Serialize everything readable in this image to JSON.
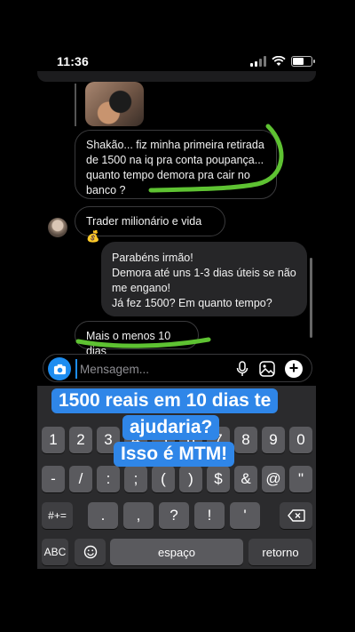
{
  "status_bar": {
    "time": "11:36"
  },
  "messages": [
    {
      "id": "m1",
      "direction": "incoming",
      "text": "Shakão... fiz minha primeira retirada de 1500 na iq pra conta poupança... quanto tempo demora pra cair no banco ?"
    },
    {
      "id": "m2",
      "direction": "incoming",
      "text": "Trader milionário e vida💰"
    },
    {
      "id": "m3",
      "direction": "outgoing",
      "text": "Parabéns irmão!\nDemora até uns 1-3 dias úteis se não me engano!\nJá fez 1500? Em quanto tempo?"
    },
    {
      "id": "m4",
      "direction": "incoming",
      "text": "Mais o menos 10 dias"
    }
  ],
  "composer": {
    "placeholder": "Mensagem..."
  },
  "keyboard": {
    "row1": [
      "1",
      "2",
      "3",
      "4",
      "5",
      "6",
      "7",
      "8",
      "9",
      "0"
    ],
    "row2": [
      "-",
      "/",
      ":",
      ";",
      "(",
      ")",
      "$",
      "&",
      "@",
      "\""
    ],
    "row3": [
      "#+=",
      ".",
      ",",
      "?",
      "!",
      "'"
    ],
    "row4": {
      "abc": "ABC",
      "space": "espaço",
      "return": "retorno"
    }
  },
  "caption": {
    "line1": "1500 reais em 10 dias te",
    "line2": "ajudaria?",
    "line3": "Isso é MTM!"
  },
  "colors": {
    "accent": "#2f86e8",
    "highlight": "#5ec232",
    "bubble_out": "#262628"
  },
  "icons": [
    "camera-icon",
    "microphone-icon",
    "gallery-icon",
    "plus-icon",
    "backspace-icon",
    "emoji-icon",
    "battery-icon",
    "wifi-icon",
    "signal-icon"
  ]
}
